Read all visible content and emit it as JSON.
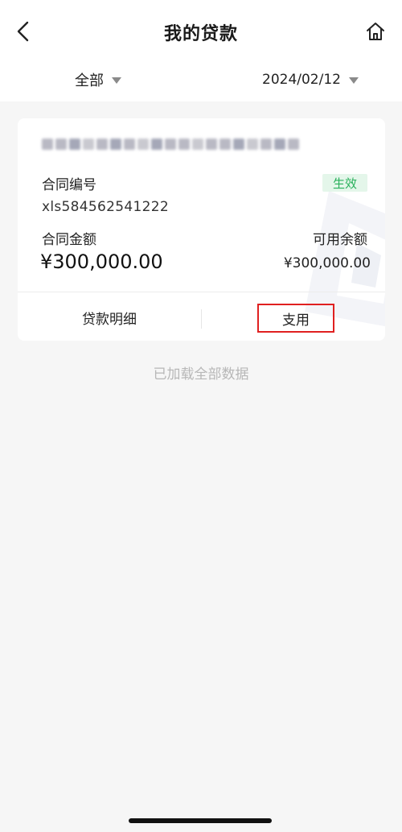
{
  "header": {
    "title": "我的贷款",
    "back_icon": "chevron-left-icon",
    "home_icon": "home-icon"
  },
  "filters": {
    "category": "全部",
    "date": "2024/02/12"
  },
  "loan_card": {
    "lender_name_blurred": true,
    "contract_no_label": "合同编号",
    "contract_no": "xls584562541222",
    "status": "生效",
    "status_color": "#28b05a",
    "contract_amount_label": "合同金额",
    "contract_amount": "¥300,000.00",
    "available_label": "可用余额",
    "available_amount": "¥300,000.00",
    "actions": {
      "detail": "贷款明细",
      "withdraw": "支用"
    },
    "highlight_color": "#e02020"
  },
  "footer": {
    "load_status": "已加载全部数据"
  }
}
